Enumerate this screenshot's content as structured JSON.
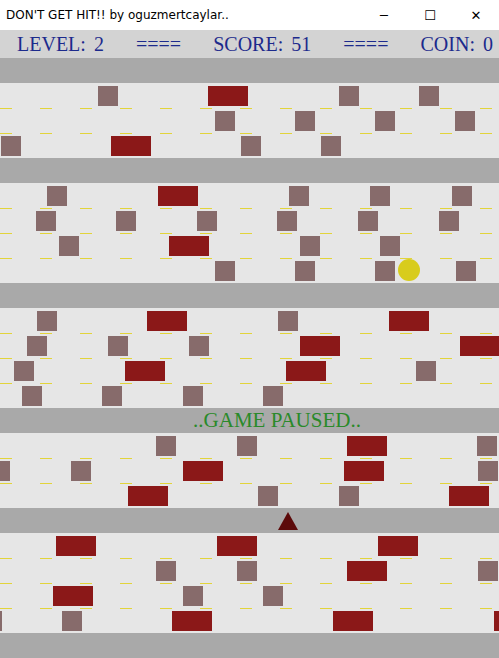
{
  "window": {
    "title": "DON'T GET HIT!! by oguzmertcaylar..",
    "controls": [
      "─",
      "☐",
      "✕"
    ]
  },
  "hud": {
    "separator": "====",
    "items": [
      {
        "label": "LEVEL:",
        "value": "2"
      },
      {
        "label": "SCORE:",
        "value": "51"
      },
      {
        "label": "COIN:",
        "value": "0"
      }
    ]
  },
  "rows": [
    {
      "kind": "band"
    },
    {
      "kind": "road",
      "lanes": [
        {
          "objects": [
            {
              "kind": "car"
            },
            {
              "kind": "truck"
            },
            {
              "kind": "car"
            },
            {
              "kind": "car"
            }
          ]
        },
        {
          "objects": [
            {
              "kind": "car"
            },
            {
              "kind": "car"
            },
            {
              "kind": "car"
            },
            {
              "kind": "car"
            }
          ]
        },
        {
          "objects": [
            {
              "kind": "car"
            },
            {
              "kind": "truck"
            },
            {
              "kind": "car"
            },
            {
              "kind": "car"
            }
          ]
        }
      ]
    },
    {
      "kind": "band"
    },
    {
      "kind": "road",
      "lanes": [
        {
          "objects": [
            {
              "kind": "car"
            },
            {
              "kind": "truck"
            },
            {
              "kind": "car"
            },
            {
              "kind": "car"
            },
            {
              "kind": "car"
            }
          ]
        },
        {
          "objects": [
            {
              "kind": "car"
            },
            {
              "kind": "car"
            },
            {
              "kind": "car"
            },
            {
              "kind": "car"
            },
            {
              "kind": "car"
            },
            {
              "kind": "car"
            }
          ]
        },
        {
          "objects": [
            {
              "kind": "car"
            },
            {
              "kind": "truck"
            },
            {
              "kind": "car"
            },
            {
              "kind": "car"
            }
          ]
        },
        {
          "objects": [
            {
              "kind": "car"
            },
            {
              "kind": "car"
            },
            {
              "kind": "car"
            },
            {
              "kind": "coin"
            },
            {
              "kind": "car"
            }
          ]
        }
      ]
    },
    {
      "kind": "band"
    },
    {
      "kind": "road",
      "lanes": [
        {
          "objects": [
            {
              "kind": "car"
            },
            {
              "kind": "truck"
            },
            {
              "kind": "car"
            },
            {
              "kind": "truck"
            }
          ]
        },
        {
          "objects": [
            {
              "kind": "car"
            },
            {
              "kind": "car"
            },
            {
              "kind": "car"
            },
            {
              "kind": "truck"
            },
            {
              "kind": "truck"
            }
          ]
        },
        {
          "objects": [
            {
              "kind": "car"
            },
            {
              "kind": "truck"
            },
            {
              "kind": "truck"
            },
            {
              "kind": "car"
            }
          ]
        },
        {
          "objects": [
            {
              "kind": "car"
            },
            {
              "kind": "car"
            },
            {
              "kind": "car"
            },
            {
              "kind": "car"
            }
          ]
        }
      ]
    },
    {
      "kind": "band",
      "label": "..GAME PAUSED.."
    },
    {
      "kind": "road",
      "lanes": [
        {
          "objects": [
            {
              "kind": "car"
            },
            {
              "kind": "car"
            },
            {
              "kind": "truck"
            },
            {
              "kind": "car"
            }
          ]
        },
        {
          "objects": [
            {
              "kind": "car"
            },
            {
              "kind": "car"
            },
            {
              "kind": "truck"
            },
            {
              "kind": "truck"
            },
            {
              "kind": "car"
            }
          ]
        },
        {
          "objects": [
            {
              "kind": "truck"
            },
            {
              "kind": "car"
            },
            {
              "kind": "car"
            },
            {
              "kind": "truck"
            }
          ]
        }
      ]
    },
    {
      "kind": "band",
      "player": true
    },
    {
      "kind": "road",
      "lanes": [
        {
          "objects": [
            {
              "kind": "truck"
            },
            {
              "kind": "truck"
            },
            {
              "kind": "truck"
            }
          ]
        },
        {
          "objects": [
            {
              "kind": "car"
            },
            {
              "kind": "car"
            },
            {
              "kind": "truck"
            },
            {
              "kind": "car"
            }
          ]
        },
        {
          "objects": [
            {
              "kind": "truck"
            },
            {
              "kind": "car"
            },
            {
              "kind": "car"
            }
          ]
        },
        {
          "objects": [
            {
              "kind": "car"
            },
            {
              "kind": "car"
            },
            {
              "kind": "truck"
            },
            {
              "kind": "truck"
            },
            {
              "kind": "truck"
            }
          ]
        }
      ]
    },
    {
      "kind": "band"
    }
  ]
}
